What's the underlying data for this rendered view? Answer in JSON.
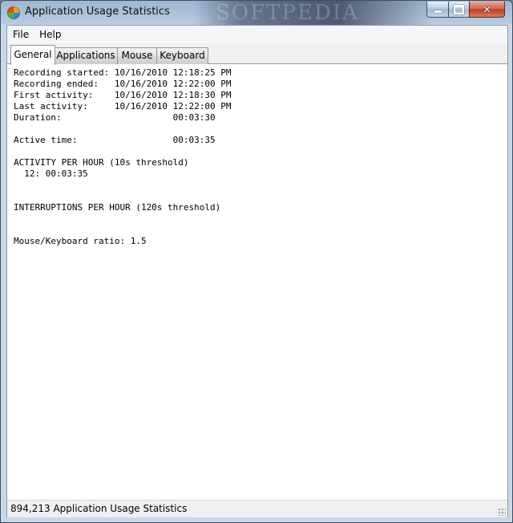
{
  "window": {
    "title": "Application Usage Statistics",
    "watermark": "SOFTPEDIA"
  },
  "menu": {
    "items": [
      "File",
      "Help"
    ]
  },
  "tabs": [
    "General",
    "Applications",
    "Mouse",
    "Keyboard"
  ],
  "general": {
    "lines": [
      "Recording started: 10/16/2010 12:18:25 PM",
      "Recording ended:   10/16/2010 12:22:00 PM",
      "First activity:    10/16/2010 12:18:30 PM",
      "Last activity:     10/16/2010 12:22:00 PM",
      "Duration:                     00:03:30",
      "",
      "Active time:                  00:03:35",
      "",
      "ACTIVITY PER HOUR (10s threshold)",
      "  12: 00:03:35",
      "",
      "",
      "INTERRUPTIONS PER HOUR (120s threshold)",
      "",
      "",
      "Mouse/Keyboard ratio: 1.5"
    ]
  },
  "status": {
    "text": "894,213  Application Usage Statistics"
  }
}
